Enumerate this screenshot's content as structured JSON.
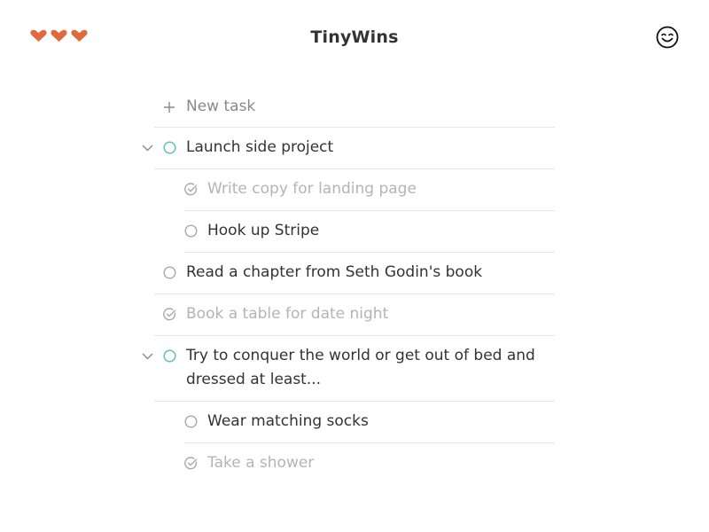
{
  "app": {
    "title": "TinyWins"
  },
  "header": {
    "hearts": [
      "heart-icon",
      "heart-icon",
      "heart-icon"
    ],
    "heart_color": "#e0693d",
    "account_icon": "smiley-icon"
  },
  "colors": {
    "open_circle": "#a8a8a8",
    "parent_circle": "#5cc5ad",
    "done_check": "#a8a8a8",
    "divider": "#e6e6e6"
  },
  "new_task": {
    "label": "New task",
    "icon": "plus-icon"
  },
  "tasks": [
    {
      "text": "Launch side project",
      "status": "open",
      "parent": true,
      "expanded": true
    },
    {
      "text": "Write copy for landing page",
      "status": "done",
      "sub": true
    },
    {
      "text": "Hook up Stripe",
      "status": "open",
      "sub": true
    },
    {
      "text": "Read a chapter from Seth Godin's book",
      "status": "open"
    },
    {
      "text": "Book a table for date night",
      "status": "done"
    },
    {
      "text": "Try to conquer the world or get out of bed and dressed at least...",
      "status": "open",
      "parent": true,
      "expanded": true
    },
    {
      "text": "Wear matching socks",
      "status": "open",
      "sub": true
    },
    {
      "text": "Take a shower",
      "status": "done",
      "sub": true
    }
  ]
}
